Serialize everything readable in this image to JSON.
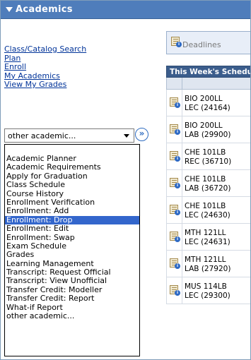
{
  "header": {
    "title": "Academics"
  },
  "links": [
    {
      "label": "Class/Catalog Search"
    },
    {
      "label": "Plan"
    },
    {
      "label": "Enroll"
    },
    {
      "label": "My Academics"
    },
    {
      "label": "View My Grades"
    }
  ],
  "select": {
    "value": "other academic...",
    "go_symbol": "»"
  },
  "dropdown": {
    "options": [
      "Academic Planner",
      "Academic Requirements",
      "Apply for Graduation",
      "Class Schedule",
      "Course History",
      "Enrollment Verification",
      "Enrollment: Add",
      "Enrollment: Drop",
      "Enrollment: Edit",
      "Enrollment: Swap",
      "Exam Schedule",
      "Grades",
      "Learning Management",
      "Transcript: Request Official",
      "Transcript: View Unofficial",
      "Transfer Credit: Modeller",
      "Transfer Credit: Report",
      "What-if Report",
      "other academic..."
    ],
    "selected": "Enrollment: Drop"
  },
  "deadlines": {
    "tab_label": "Deadlines",
    "week_header": "This Week's Schedule",
    "rows": [
      {
        "course": "BIO 200LL",
        "detail": "LEC (24164)"
      },
      {
        "course": "BIO 200LL",
        "detail": "LAB (29900)"
      },
      {
        "course": "CHE 101LB",
        "detail": "REC (36710)"
      },
      {
        "course": "CHE 101LB",
        "detail": "LAB (36720)"
      },
      {
        "course": "CHE 101LB",
        "detail": "LEC (24630)"
      },
      {
        "course": "MTH 121LL",
        "detail": "LEC (24631)"
      },
      {
        "course": "MTH 121LL",
        "detail": "LAB (27920)"
      },
      {
        "course": "MUS 114LB",
        "detail": "LEC (29300)"
      }
    ]
  },
  "icons": {
    "calendar_info": "calendar-info-icon"
  }
}
